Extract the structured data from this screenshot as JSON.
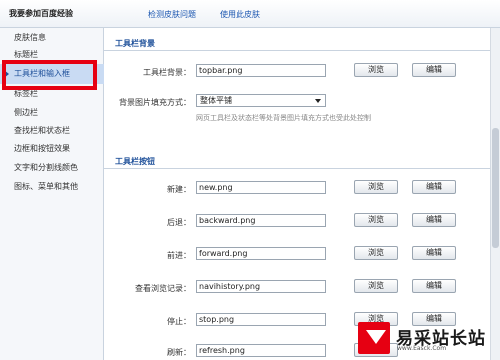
{
  "header": {
    "title": "我要参加百度经验",
    "links": [
      "检测皮肤问题",
      "使用此皮肤"
    ]
  },
  "sidebar": {
    "items": [
      {
        "label": "皮肤信息"
      },
      {
        "label": "标题栏"
      },
      {
        "label": "工具栏和输入框",
        "active": true
      },
      {
        "label": "标签栏"
      },
      {
        "label": "侧边栏"
      },
      {
        "label": "查找栏和状态栏"
      },
      {
        "label": "边框和按钮效果"
      },
      {
        "label": "文字和分割线颜色"
      },
      {
        "label": "图标、菜单和其他"
      }
    ]
  },
  "bg_section": {
    "title": "工具栏背景",
    "bg_label": "工具栏背景：",
    "bg_value": "topbar.png",
    "fill_label": "背景图片填充方式：",
    "fill_value": "整体平铺",
    "hint": "网页工具栏及状态栏等处背景图片填充方式也受此处控制",
    "browse_label": "浏览",
    "edit_label": "编辑"
  },
  "buttons_section": {
    "title": "工具栏按钮",
    "browse_label": "浏览",
    "edit_label": "编辑",
    "rows": [
      {
        "label": "新建：",
        "value": "new.png"
      },
      {
        "label": "后退：",
        "value": "backward.png"
      },
      {
        "label": "前进：",
        "value": "forward.png"
      },
      {
        "label": "查看浏览记录：",
        "value": "navihistory.png"
      },
      {
        "label": "停止：",
        "value": "stop.png"
      },
      {
        "label": "刷新：",
        "value": "refresh.png"
      }
    ]
  },
  "watermark": {
    "text": "易采站长站",
    "sub": "www.Easck.Com"
  },
  "colors": {
    "highlight": "#e60012",
    "section_title": "#1d4f99",
    "active_bg": "#c9dbf3"
  }
}
